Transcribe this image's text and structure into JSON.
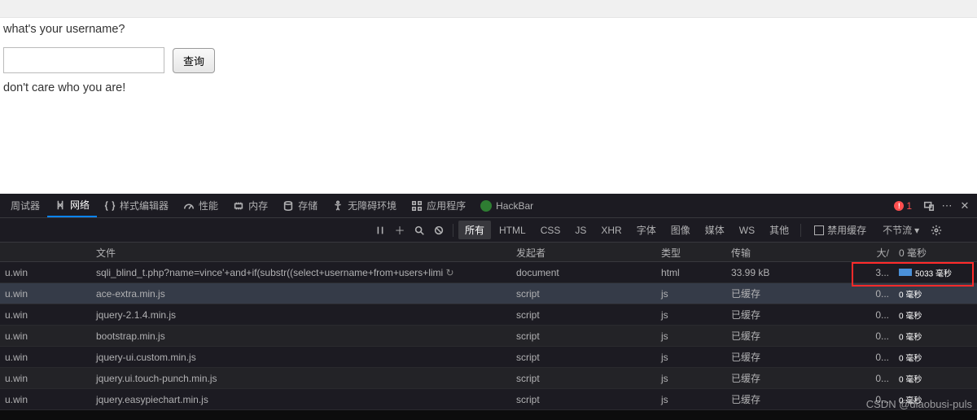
{
  "page": {
    "prompt": "what's your username?",
    "button": "查询",
    "response": "don't care who you are!"
  },
  "tabs": {
    "debugger": "周试器",
    "network": "网络",
    "style": "样式编辑器",
    "perf": "性能",
    "memory": "内存",
    "storage": "存储",
    "a11y": "无障碍环境",
    "apps": "应用程序",
    "hackbar": "HackBar",
    "error_count": "1"
  },
  "filters": {
    "all": "所有",
    "html": "HTML",
    "css": "CSS",
    "js": "JS",
    "xhr": "XHR",
    "fonts": "字体",
    "images": "图像",
    "media": "媒体",
    "ws": "WS",
    "other": "其他",
    "disable_cache": "禁用缓存",
    "throttle": "不节流"
  },
  "columns": {
    "domain": "",
    "file": "文件",
    "initiator": "发起者",
    "type": "类型",
    "transfer": "传输",
    "size": "大/",
    "time": "0 毫秒"
  },
  "rows": [
    {
      "domain": "u.win",
      "file": "sqli_blind_t.php?name=vince'+and+if(substr((select+username+from+users+limi",
      "initiator": "document",
      "type": "html",
      "transfer": "33.99 kB",
      "size": "3...",
      "time": "5033 毫秒",
      "hl": true,
      "selected": false
    },
    {
      "domain": "u.win",
      "file": "ace-extra.min.js",
      "initiator": "script",
      "type": "js",
      "transfer": "已缓存",
      "size": "0...",
      "time": "0 毫秒",
      "selected": true
    },
    {
      "domain": "u.win",
      "file": "jquery-2.1.4.min.js",
      "initiator": "script",
      "type": "js",
      "transfer": "已缓存",
      "size": "0...",
      "time": "0 毫秒"
    },
    {
      "domain": "u.win",
      "file": "bootstrap.min.js",
      "initiator": "script",
      "type": "js",
      "transfer": "已缓存",
      "size": "0...",
      "time": "0 毫秒"
    },
    {
      "domain": "u.win",
      "file": "jquery-ui.custom.min.js",
      "initiator": "script",
      "type": "js",
      "transfer": "已缓存",
      "size": "0...",
      "time": "0 毫秒"
    },
    {
      "domain": "u.win",
      "file": "jquery.ui.touch-punch.min.js",
      "initiator": "script",
      "type": "js",
      "transfer": "已缓存",
      "size": "0...",
      "time": "0 毫秒"
    },
    {
      "domain": "u.win",
      "file": "jquery.easypiechart.min.js",
      "initiator": "script",
      "type": "js",
      "transfer": "已缓存",
      "size": "0...",
      "time": "0 毫秒"
    }
  ],
  "watermark": "CSDN @diaobusi-puls"
}
